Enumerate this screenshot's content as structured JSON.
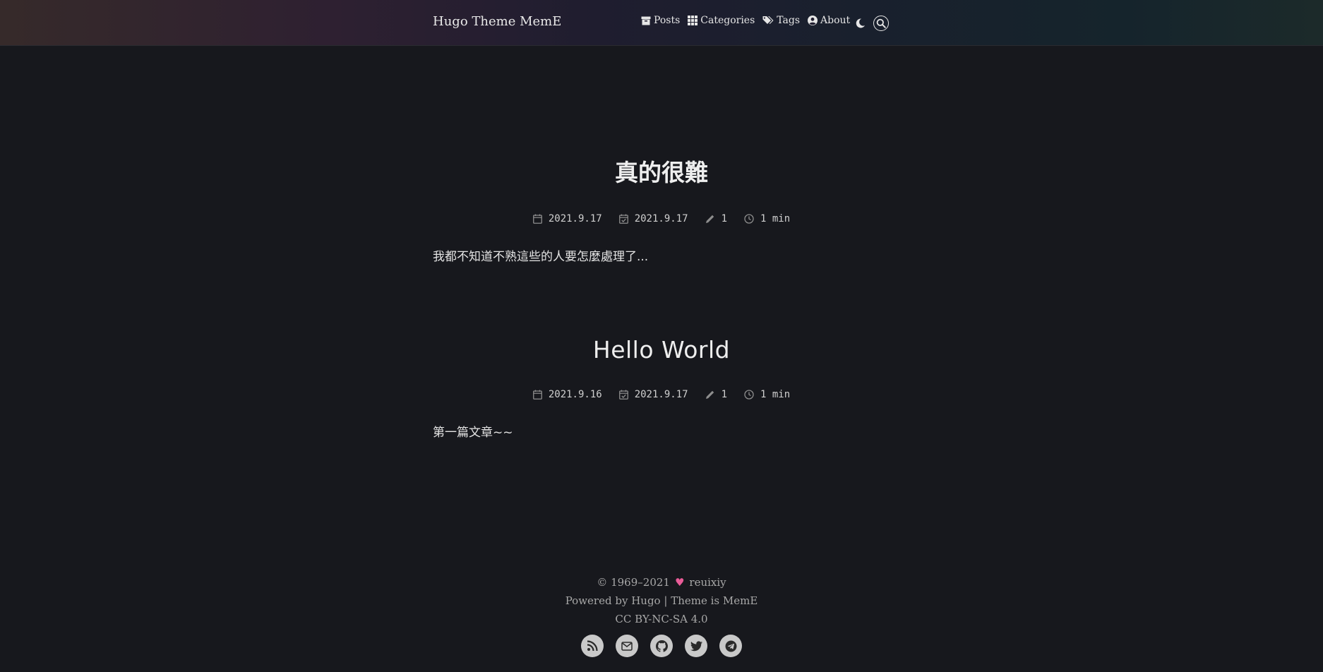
{
  "header": {
    "site_title": "Hugo Theme MemE",
    "nav": {
      "posts": "Posts",
      "categories": "Categories",
      "tags": "Tags",
      "about": "About"
    }
  },
  "posts": [
    {
      "title": "真的很難",
      "published": "2021.9.17",
      "updated": "2021.9.17",
      "words": "1",
      "read_time": "1 min",
      "summary": "我都不知道不熟這些的人要怎麼處理了..."
    },
    {
      "title": "Hello World",
      "published": "2021.9.16",
      "updated": "2021.9.17",
      "words": "1",
      "read_time": "1 min",
      "summary": "第一篇文章~~"
    }
  ],
  "footer": {
    "copyright": "© 1969–2021",
    "author": "reuixiy",
    "powered_by": "Powered by",
    "hugo": "Hugo",
    "separator": "|",
    "theme_is": "Theme is",
    "meme": "MemE",
    "license": "CC BY-NC-SA 4.0"
  },
  "colors": {
    "background": "#17181d",
    "heart": "#e95c98",
    "social_bg": "#c9c9c9"
  }
}
